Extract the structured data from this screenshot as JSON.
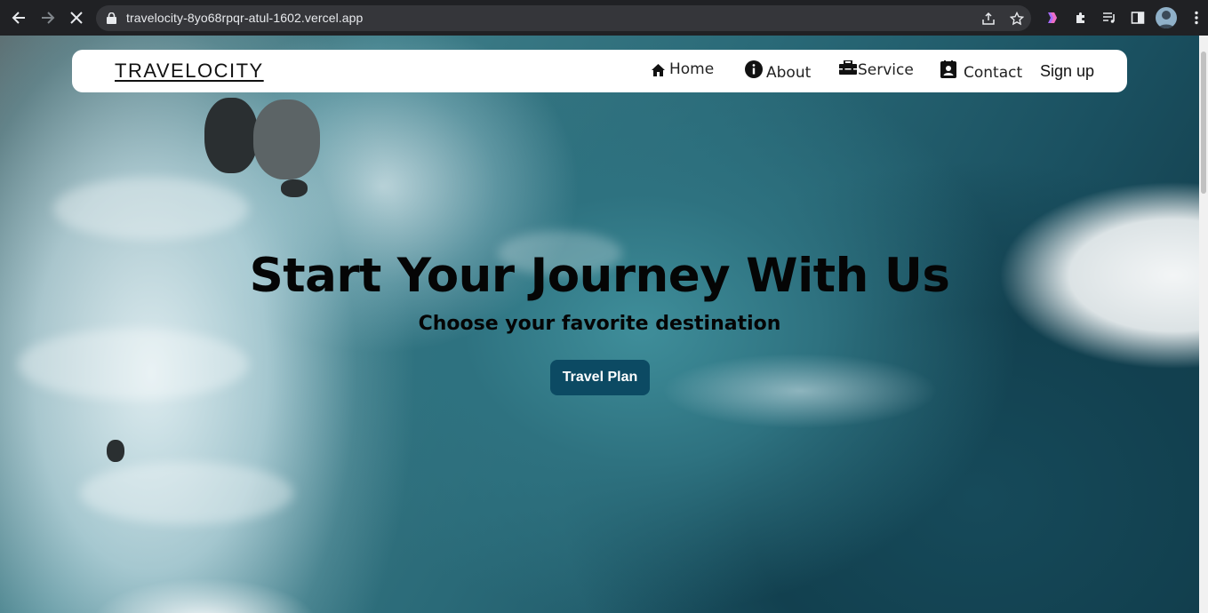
{
  "browser": {
    "url": "travelocity-8yo68rpqr-atul-1602.vercel.app",
    "icons": [
      "back-icon",
      "forward-icon",
      "stop-icon",
      "lock-icon",
      "share-icon",
      "star-icon",
      "extension-colorful-icon",
      "puzzle-icon",
      "media-queue-icon",
      "side-panel-icon",
      "profile-avatar",
      "menu-dots-icon"
    ]
  },
  "navbar": {
    "brand": "TRAVELOCITY",
    "items": [
      {
        "label": "Home",
        "icon": "home-icon"
      },
      {
        "label": "About",
        "icon": "info-icon"
      },
      {
        "label": "Service",
        "icon": "toolbox-icon"
      },
      {
        "label": "Contact",
        "icon": "contact-card-icon"
      }
    ],
    "signup": "Sign up"
  },
  "hero": {
    "title": "Start Your Journey With Us",
    "subtitle": "Choose your favorite destination",
    "button": "Travel Plan",
    "button_color": "#0c4a63"
  }
}
